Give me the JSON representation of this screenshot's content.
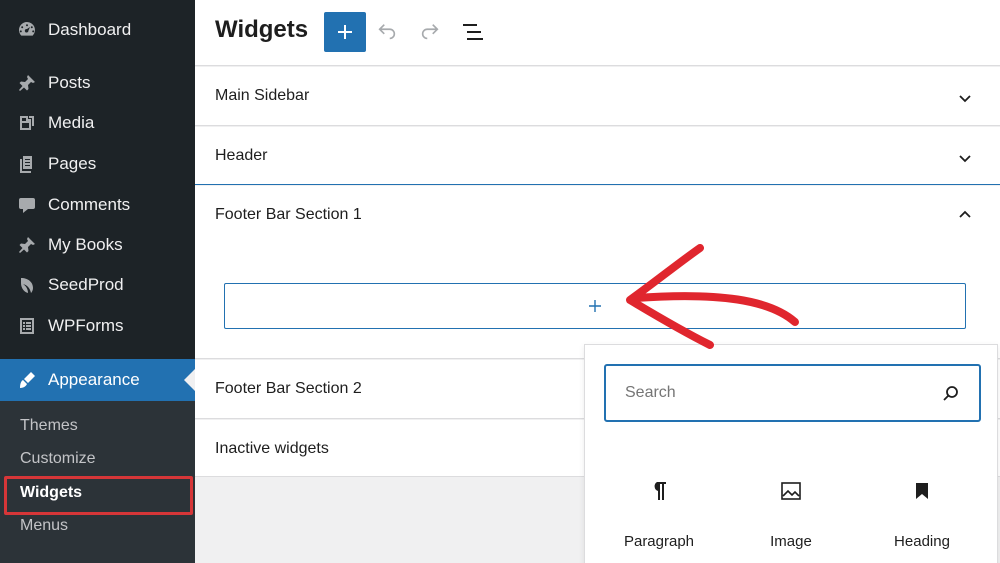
{
  "sidebar": {
    "items": [
      {
        "label": "Dashboard",
        "icon": "dashboard-icon"
      },
      {
        "label": "Posts",
        "icon": "pin-icon"
      },
      {
        "label": "Media",
        "icon": "media-icon"
      },
      {
        "label": "Pages",
        "icon": "pages-icon"
      },
      {
        "label": "Comments",
        "icon": "comment-icon"
      },
      {
        "label": "My Books",
        "icon": "pin-icon"
      },
      {
        "label": "SeedProd",
        "icon": "seedprod-icon"
      },
      {
        "label": "WPForms",
        "icon": "forms-icon"
      },
      {
        "label": "Appearance",
        "icon": "brush-icon"
      }
    ],
    "submenu": [
      "Themes",
      "Customize",
      "Widgets",
      "Menus"
    ],
    "current_submenu": "Widgets"
  },
  "header": {
    "title": "Widgets",
    "add_label": "+"
  },
  "areas": [
    {
      "title": "Main Sidebar",
      "expanded": false
    },
    {
      "title": "Header",
      "expanded": false
    },
    {
      "title": "Footer Bar Section 1",
      "expanded": true
    },
    {
      "title": "Footer Bar Section 2",
      "expanded": false
    },
    {
      "title": "Inactive widgets",
      "expanded": false
    }
  ],
  "appender": {
    "label": "+"
  },
  "inserter": {
    "search_placeholder": "Search",
    "blocks": [
      {
        "label": "Paragraph",
        "icon": "paragraph-icon"
      },
      {
        "label": "Image",
        "icon": "image-icon"
      },
      {
        "label": "Heading",
        "icon": "bookmark-icon"
      }
    ]
  },
  "colors": {
    "sidebar_bg": "#1d2327",
    "accent": "#2271b1",
    "highlight": "#d63638",
    "annotation_arrow": "#e0262e"
  }
}
